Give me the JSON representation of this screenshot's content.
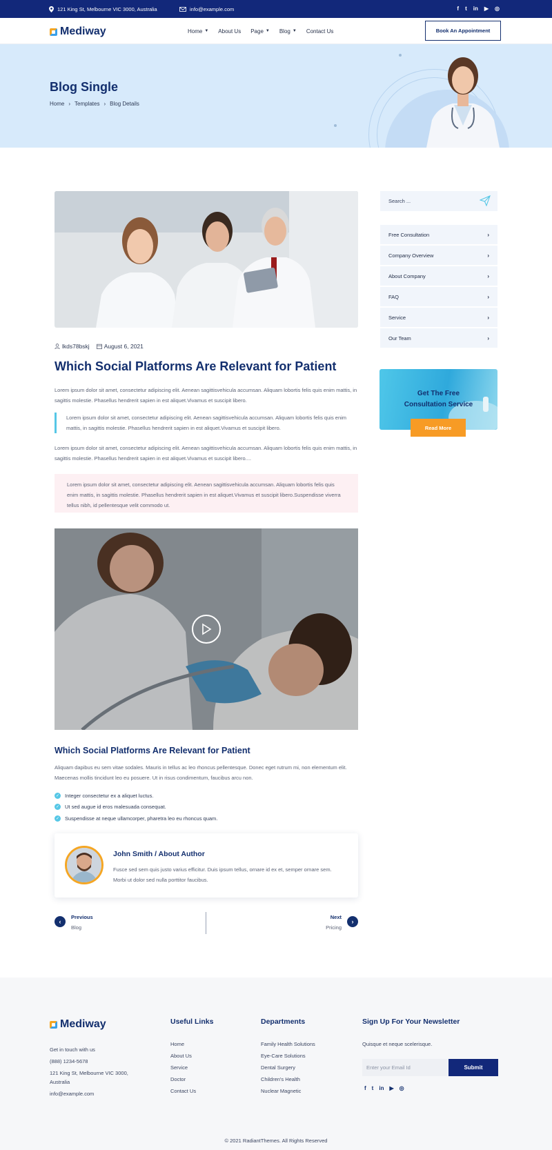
{
  "topbar": {
    "address": "121 King St, Melbourne VIC 3000, Australia",
    "email": "info@example.com",
    "social": [
      "f",
      "t",
      "in",
      "▶",
      "◎"
    ]
  },
  "nav": {
    "brand": "Mediway",
    "menu": [
      {
        "label": "Home",
        "dropdown": true
      },
      {
        "label": "About Us",
        "dropdown": false
      },
      {
        "label": "Page",
        "dropdown": true
      },
      {
        "label": "Blog",
        "dropdown": true
      },
      {
        "label": "Contact Us",
        "dropdown": false
      }
    ],
    "appointment": "Book An Appointment"
  },
  "hero": {
    "title": "Blog Single",
    "breadcrumb": [
      "Home",
      "Templates",
      "Blog Details"
    ]
  },
  "post": {
    "author": "lkds78bskj",
    "date": "August 6, 2021",
    "title": "Which Social Platforms Are Relevant for Patient",
    "p1": "Lorem ipsum dolor sit amet, consectetur adipiscing elit. Aenean sagittisvehicula accumsan. Aliquam lobortis felis quis enim mattis, in sagittis molestie. Phasellus hendrerit sapien in est aliquet.Vivamus et suscipit libero.",
    "quote": "Lorem ipsum dolor sit amet, consectetur adipiscing elit. Aenean sagittisvehicula accumsan. Aliquam lobortis felis quis enim mattis, in sagittis molestie. Phasellus hendrerit sapien in est aliquet.Vivamus et suscipit libero.",
    "p2": "Lorem ipsum dolor sit amet, consectetur adipiscing elit. Aenean sagittisvehicula accumsan. Aliquam lobortis felis quis enim mattis, in sagittis molestie. Phasellus hendrerit sapien in est aliquet.Vivamus et suscipit libero....",
    "highlight": "Lorem ipsum dolor sit amet, consectetur adipiscing elit. Aenean sagittisvehicula accumsan. Aliquam lobortis felis quis enim mattis, in sagittis molestie. Phasellus hendrerit sapien in est aliquet.Vivamus et suscipit libero.Suspendisse viverra tellus nibh, id pellentesque velit commodo ut.",
    "subtitle": "Which Social Platforms Are Relevant for Patient",
    "p3": "Aliquam dapibus eu sem vitae sodales. Mauris in tellus ac leo rhoncus pellentesque. Donec eget rutrum mi, non elementum elit. Maecenas mollis tincidunt leo eu posuere. Ut in risus condimentum, faucibus arcu non.",
    "checklist": [
      "Integer consectetur ex a aliquet luctus.",
      "Ut sed augue id eros malesuada consequat.",
      "Suspendisse at neque ullamcorper, pharetra leo eu rhoncus quam."
    ]
  },
  "author_box": {
    "name": "John Smith / About Author",
    "bio": "Fusce sed sem quis justo varius efficitur. Duis ipsum tellus, ornare id ex et, semper ornare sem. Morbi ut dolor sed nulla porttitor faucibus."
  },
  "pager": {
    "prev_title": "Previous",
    "prev_sub": "Blog",
    "next_title": "Next",
    "next_sub": "Pricing"
  },
  "sidebar": {
    "search_placeholder": "Search ...",
    "categories": [
      "Free Consultation",
      "Company Overview",
      "About Company",
      "FAQ",
      "Service",
      "Our Team"
    ],
    "promo_line1": "Get The Free",
    "promo_line2": "Consultation Service",
    "promo_button": "Read More"
  },
  "footer": {
    "brand": "Mediway",
    "contact": [
      "Get in touch with us",
      "(888) 1234-5678",
      "121 King St, Melbourne VIC 3000,",
      "Australia",
      "info@example.com"
    ],
    "useful_title": "Useful Links",
    "useful": [
      "Home",
      "About Us",
      "Service",
      "Doctor",
      "Contact Us"
    ],
    "dept_title": "Departments",
    "departments": [
      "Family Health Solutions",
      "Eye-Care Solutions",
      "Dental Surgery",
      "Children's Health",
      "Nuclear Magnetic"
    ],
    "news_title": "Sign Up For Your Newsletter",
    "news_text": "Quisque et neque scelerisque.",
    "email_placeholder": "Enter your Email Id",
    "submit": "Submit",
    "social": [
      "f",
      "t",
      "in",
      "▶",
      "◎"
    ],
    "copyright": "© 2021 RadiantThemes. All Rights Reserved"
  },
  "colors": {
    "navy": "#12287a",
    "accent": "#56c7e6",
    "orange": "#f79b25"
  }
}
